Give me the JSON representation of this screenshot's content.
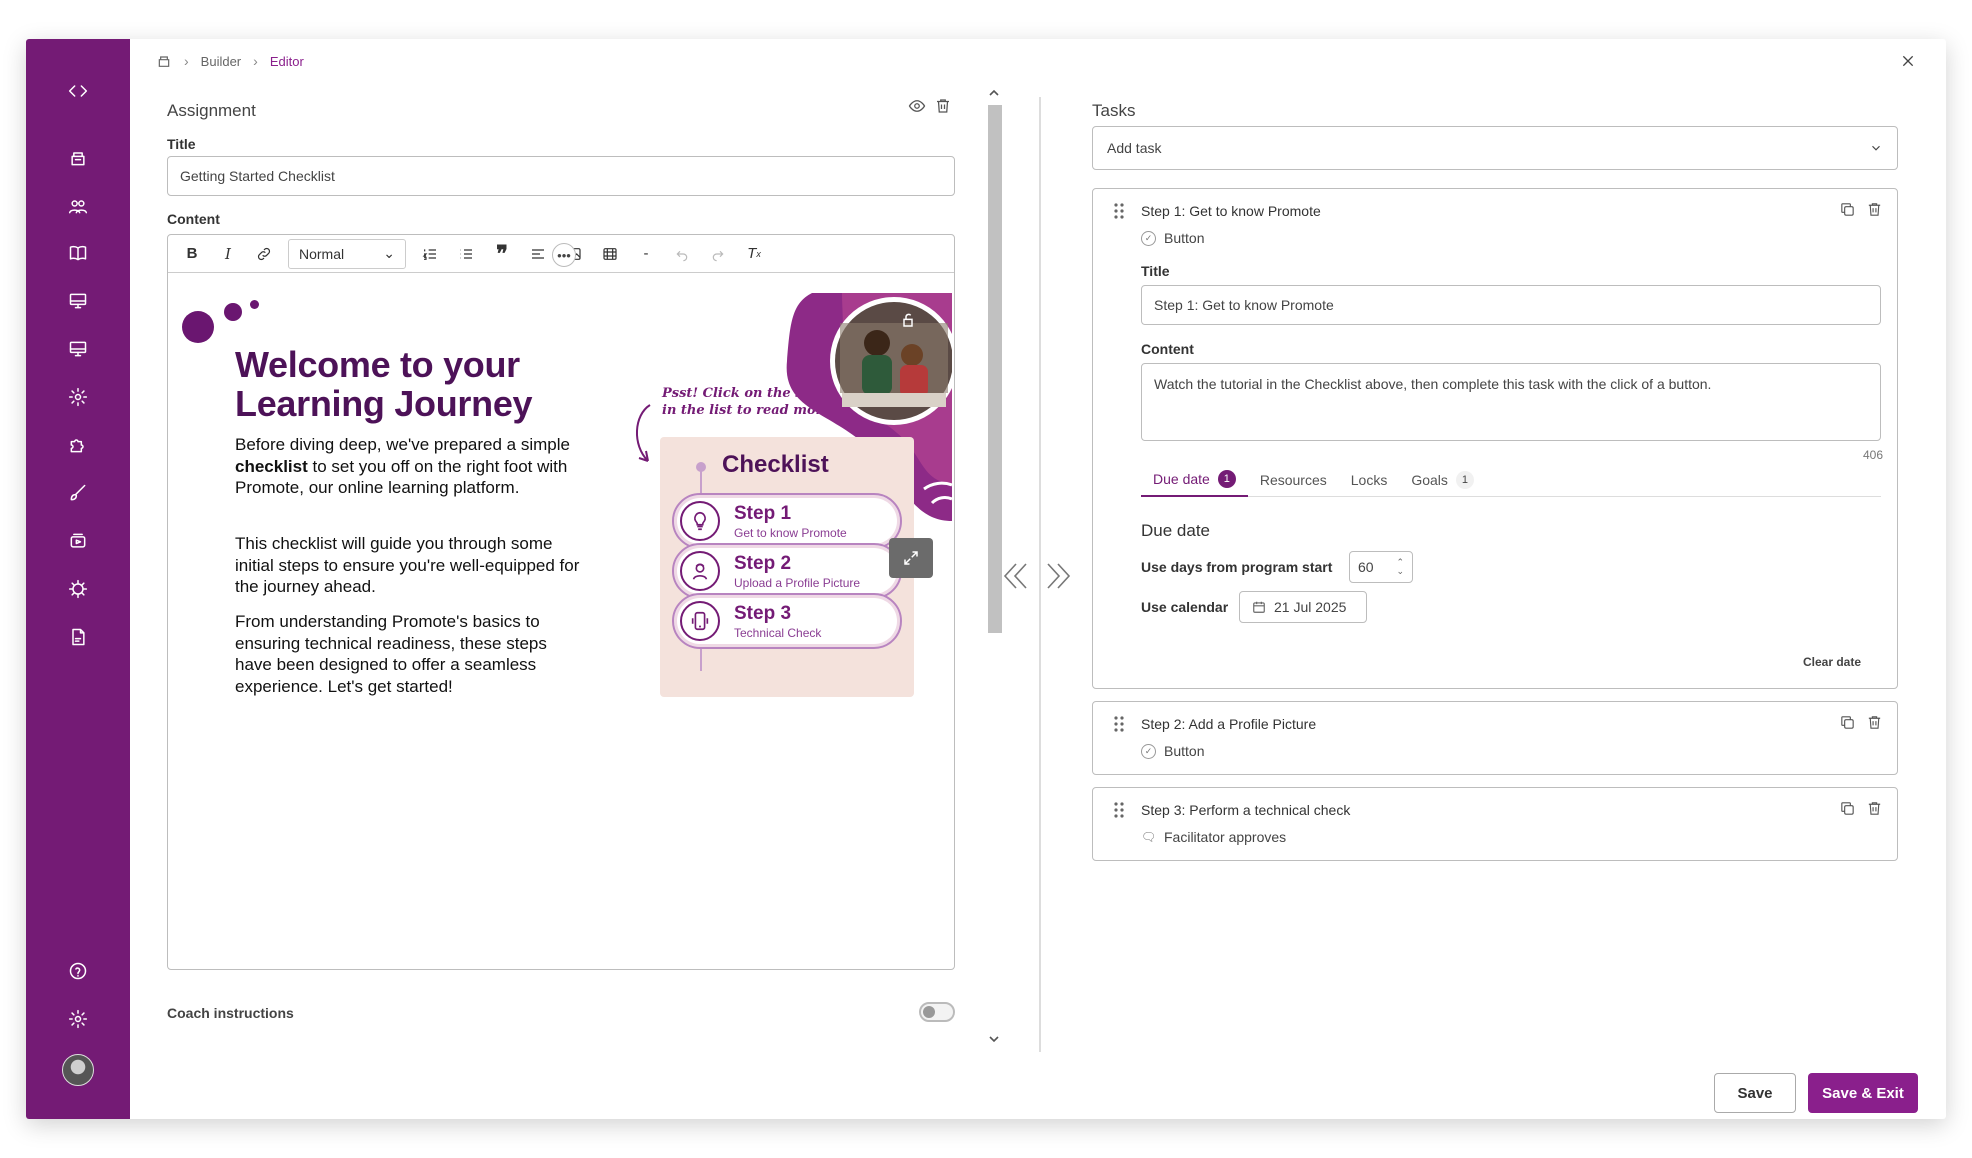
{
  "breadcrumb": {
    "builder": "Builder",
    "editor": "Editor"
  },
  "assignment": {
    "section_title": "Assignment",
    "title_label": "Title",
    "title_value": "Getting Started Checklist",
    "content_label": "Content",
    "format_select": "Normal",
    "coach_label": "Coach instructions"
  },
  "banner": {
    "heading_line1": "Welcome to your",
    "heading_line2": "Learning Journey",
    "para1_a": "Before diving deep, we've prepared a simple ",
    "para1_b": "checklist",
    "para1_c": " to set you off on the right foot with Promote, our online learning platform.",
    "para2": "This checklist will guide you through some initial steps to ensure you're well-equipped for the journey ahead.",
    "para3": "From understanding Promote's basics to ensuring technical readiness, these steps have been designed to offer a seamless experience. Let's get started!",
    "psst_line1": "Psst! Click on the steps",
    "psst_line2": "in the list to read more.",
    "checklist_title": "Checklist",
    "steps": [
      {
        "title": "Step 1",
        "sub": "Get to know Promote"
      },
      {
        "title": "Step 2",
        "sub": "Upload a Profile Picture"
      },
      {
        "title": "Step 3",
        "sub": "Technical Check"
      }
    ]
  },
  "tasks": {
    "section_title": "Tasks",
    "add_task": "Add task",
    "card1": {
      "title": "Step 1: Get to know Promote",
      "type": "Button",
      "title_label": "Title",
      "title_value": "Step 1: Get to know Promote",
      "content_label": "Content",
      "content_value": "Watch the tutorial in the Checklist above, then complete this task with the click of a button.",
      "char_count": "406",
      "tabs": {
        "due": "Due date",
        "due_badge": "1",
        "resources": "Resources",
        "locks": "Locks",
        "goals": "Goals",
        "goals_badge": "1"
      },
      "due_heading": "Due date",
      "days_label": "Use days from program start",
      "days_value": "60",
      "calendar_label": "Use calendar",
      "calendar_value": "21 Jul 2025",
      "clear": "Clear date"
    },
    "card2": {
      "title": "Step 2: Add a Profile Picture",
      "type": "Button"
    },
    "card3": {
      "title": "Step 3: Perform a technical check",
      "type": "Facilitator approves"
    }
  },
  "footer": {
    "save": "Save",
    "save_exit": "Save & Exit"
  },
  "colors": {
    "brand": "#741b75",
    "banner_bg": "#f4e2dc"
  }
}
